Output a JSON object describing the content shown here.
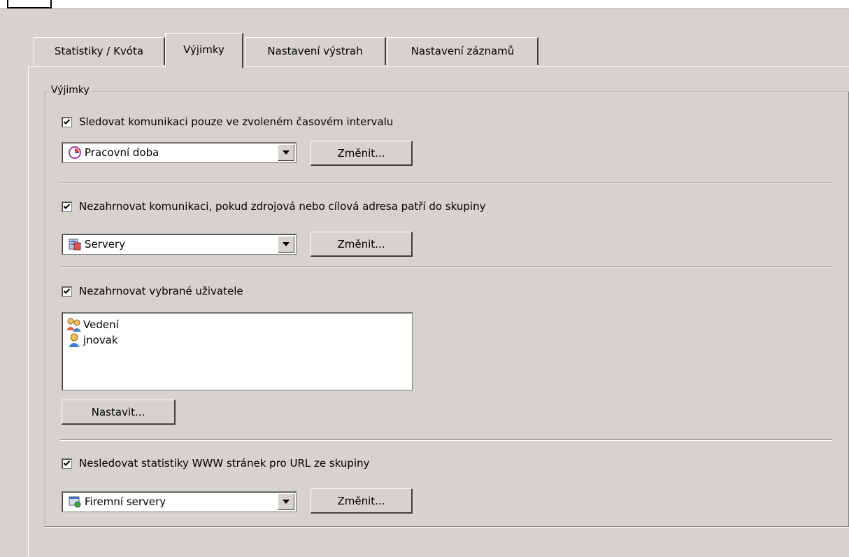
{
  "tabs": [
    {
      "label": "Statistiky / Kvóta",
      "active": false
    },
    {
      "label": "Výjimky",
      "active": true
    },
    {
      "label": "Nastavení výstrah",
      "active": false
    },
    {
      "label": "Nastavení záznamů",
      "active": false
    }
  ],
  "group": {
    "title": "Výjimky"
  },
  "section_time": {
    "checkbox_label": "Sledovat komunikaci pouze ve zvoleném časovém intervalu",
    "checked": true,
    "select_value": "Pracovní doba",
    "select_icon": "clock-icon",
    "button_label": "Změnit..."
  },
  "section_ipgroup": {
    "checkbox_label": "Nezahrnovat komunikaci, pokud zdrojová nebo cílová adresa patří do skupiny",
    "checked": true,
    "select_value": "Servery",
    "select_icon": "ip-group-icon",
    "button_label": "Změnit..."
  },
  "section_users": {
    "checkbox_label": "Nezahrnovat vybrané uživatele",
    "checked": true,
    "items": [
      {
        "label": "Vedení",
        "icon": "user-group-icon"
      },
      {
        "label": "jnovak",
        "icon": "user-icon"
      }
    ],
    "button_label": "Nastavit..."
  },
  "section_url": {
    "checkbox_label": "Nesledovat statistiky WWW stránek pro URL ze skupiny",
    "checked": true,
    "select_value": "Firemní servery",
    "select_icon": "url-group-icon",
    "button_label": "Změnit..."
  },
  "colors": {
    "background": "#d6d3ce",
    "field": "#ffffff"
  }
}
